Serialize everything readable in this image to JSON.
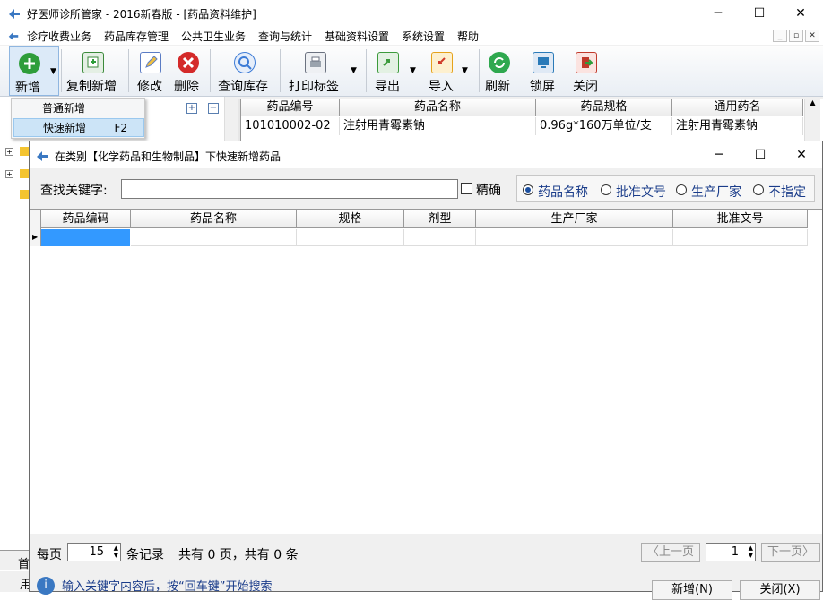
{
  "app": {
    "title": "好医师诊所管家 - 2016新春版 - [药品资料维护]",
    "window_buttons": {
      "minimize": "─",
      "maximize": "☐",
      "close": "✕"
    }
  },
  "menubar": {
    "items": [
      "诊疗收费业务",
      "药品库存管理",
      "公共卫生业务",
      "查询与统计",
      "基础资料设置",
      "系统设置",
      "帮助"
    ],
    "mdi_buttons": [
      "_",
      "▫",
      "✕"
    ]
  },
  "toolbar": {
    "items": [
      {
        "label": "新增",
        "icon": "add-icon",
        "color": "#2e9d3a"
      },
      {
        "label": "复制新增",
        "icon": "copy-icon",
        "color": "#3b8a3b"
      },
      {
        "label": "修改",
        "icon": "edit-icon",
        "color": "#5b7cc4"
      },
      {
        "label": "删除",
        "icon": "delete-icon",
        "color": "#d42a2a"
      },
      {
        "label": "查询库存",
        "icon": "search-stock-icon",
        "color": "#3c7bd6"
      },
      {
        "label": "打印标签",
        "icon": "print-icon",
        "color": "#6b7280"
      },
      {
        "label": "导出",
        "icon": "export-icon",
        "color": "#3c9a3c"
      },
      {
        "label": "导入",
        "icon": "import-icon",
        "color": "#e5a21b"
      },
      {
        "label": "刷新",
        "icon": "refresh-icon",
        "color": "#2fa84f"
      },
      {
        "label": "锁屏",
        "icon": "lock-screen-icon",
        "color": "#2a7ab8"
      },
      {
        "label": "关闭",
        "icon": "exit-icon",
        "color": "#c0392b"
      }
    ]
  },
  "context_menu": {
    "items": [
      {
        "label": "普通新增",
        "shortcut": ""
      },
      {
        "label": "快速新增",
        "shortcut": "F2"
      }
    ]
  },
  "main_grid": {
    "headers": [
      "药品编号",
      "药品名称",
      "药品规格",
      "通用药名"
    ],
    "rows": [
      [
        "101010002-02",
        "注射用青霉素钠",
        "0.96g*160万单位/支",
        "注射用青霉素钠"
      ]
    ]
  },
  "dialog": {
    "title": "在类别【化学药品和生物制品】下快速新增药品",
    "search_label": "查找关键字:",
    "search_value": "",
    "exact_label": "精确",
    "radio_options": [
      "药品名称",
      "批准文号",
      "生产厂家",
      "不指定"
    ],
    "radio_selected": "药品名称",
    "grid_headers": [
      "药品编码",
      "药品名称",
      "规格",
      "剂型",
      "生产厂家",
      "批准文号"
    ],
    "pager": {
      "per_page_label": "每页",
      "per_page_value": "15",
      "records_label": "条记录",
      "summary": "共有 0 页，共有 0 条",
      "prev_label": "〈上一页",
      "page_value": "1",
      "next_label": "下一页〉"
    },
    "hint": "输入关键字内容后，按“回车键”开始搜索",
    "new_button": "新增(N)",
    "close_button": "关闭(X)"
  },
  "behind_fragments": {
    "status_fragment_1": "首",
    "status_fragment_2": "用"
  }
}
